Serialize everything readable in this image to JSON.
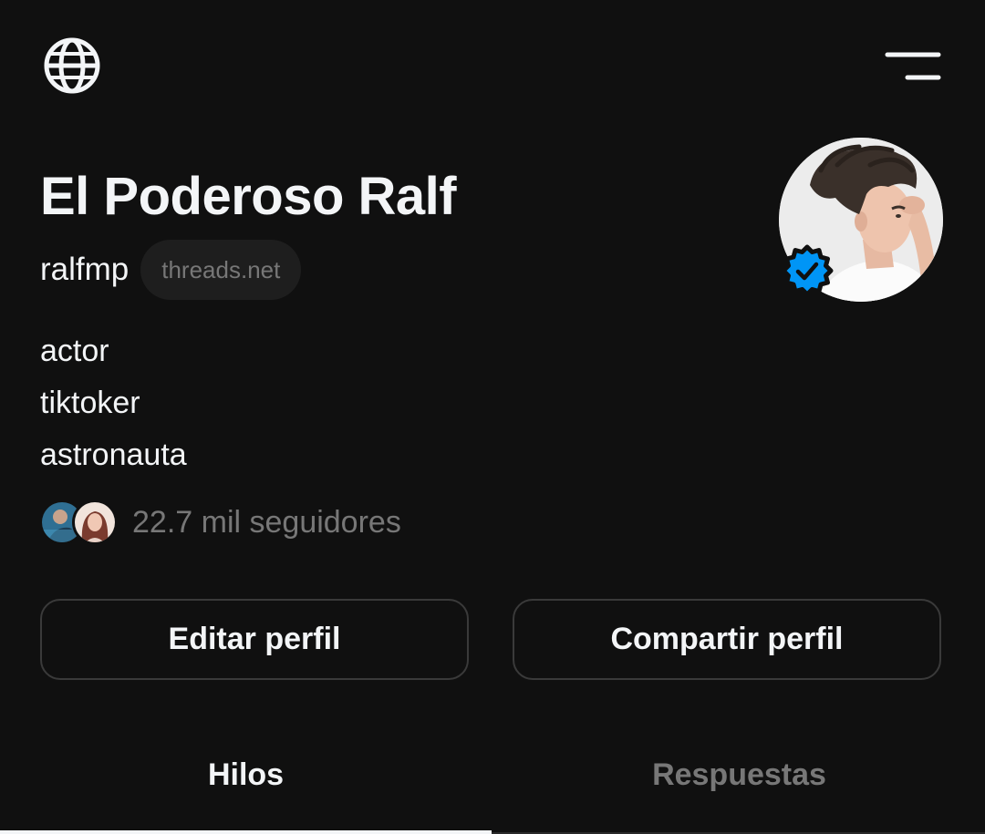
{
  "profile": {
    "display_name": "El Poderoso Ralf",
    "username": "ralfmp",
    "domain_chip": "threads.net",
    "verified": true,
    "bio_lines": [
      "actor",
      "tiktoker",
      "astronauta"
    ],
    "followers_text": "22.7 mil seguidores"
  },
  "actions": {
    "edit_label": "Editar perfil",
    "share_label": "Compartir perfil"
  },
  "tabs": [
    {
      "label": "Hilos",
      "active": true
    },
    {
      "label": "Respuestas",
      "active": false
    }
  ],
  "icons": {
    "top_left": "globe-icon",
    "top_right": "menu-icon",
    "badge": "verified-badge-icon"
  },
  "colors": {
    "background": "#101010",
    "text_primary": "#f3f5f7",
    "text_secondary": "#777777",
    "verified_blue": "#0095f6",
    "button_border": "#3a3a3a"
  }
}
